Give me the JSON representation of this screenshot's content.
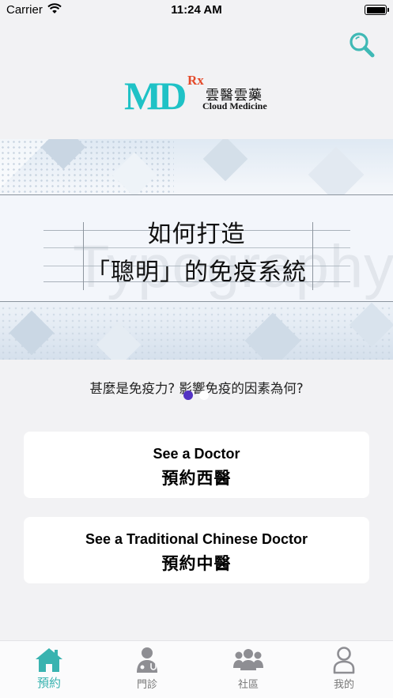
{
  "status_bar": {
    "carrier": "Carrier",
    "time": "11:24 AM"
  },
  "header": {
    "search_icon": "search-icon",
    "logo": {
      "mark": "MD",
      "rx": "Rx",
      "name_zh": "雲醫雲藥",
      "name_en": "Cloud Medicine"
    }
  },
  "banner": {
    "title_line1": "如何打造",
    "title_line2": "「聰明」的免疫系統",
    "watermark": "Typography",
    "caption": "甚麼是免疫力? 影響免疫的因素為何?",
    "page_count": 2,
    "active_page": 1
  },
  "cards": [
    {
      "title_en": "See a Doctor",
      "title_zh": "預約西醫"
    },
    {
      "title_en": "See a Traditional Chinese Doctor",
      "title_zh": "預約中醫"
    }
  ],
  "tabbar": {
    "items": [
      {
        "label": "預約",
        "icon": "home-icon",
        "active": true
      },
      {
        "label": "門診",
        "icon": "doctor-icon",
        "active": false
      },
      {
        "label": "社區",
        "icon": "community-icon",
        "active": false
      },
      {
        "label": "我的",
        "icon": "profile-icon",
        "active": false
      }
    ],
    "active_color": "#39b3b0",
    "inactive_color": "#8e8e93"
  },
  "colors": {
    "brand_teal": "#1fc2c6",
    "rx_red": "#e44a2a",
    "page_dot_active": "#5433c4"
  }
}
